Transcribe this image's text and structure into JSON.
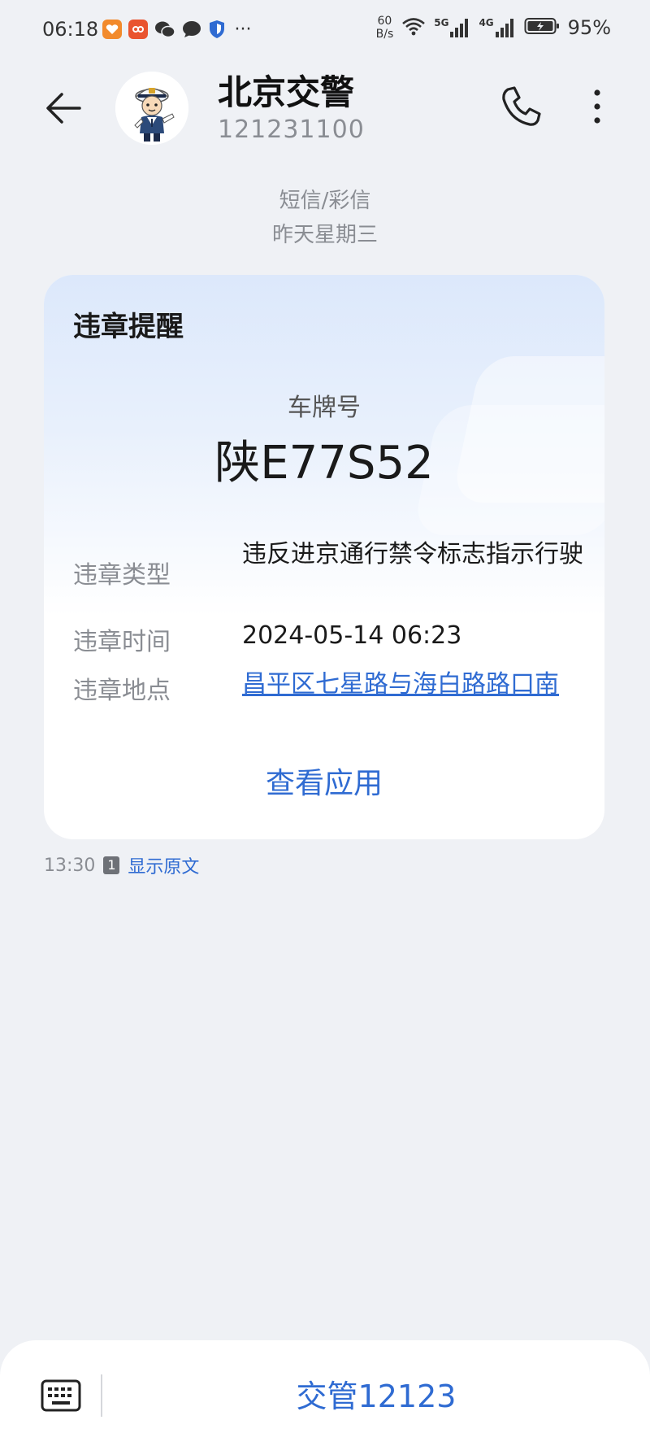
{
  "status_bar": {
    "time": "06:18",
    "net_speed_value": "60",
    "net_speed_unit": "B/s",
    "signal1_label": "5G",
    "signal2_label": "4G",
    "battery_percent": "95%",
    "more_dots": "···"
  },
  "header": {
    "contact_name": "北京交警",
    "contact_number": "121231100"
  },
  "thread": {
    "message_type": "短信/彩信",
    "date": "昨天星期三"
  },
  "card": {
    "title": "违章提醒",
    "plate_label": "车牌号",
    "plate_value": "陕E77S52",
    "rows": [
      {
        "label": "违章类型",
        "value": "违反进京通行禁令标志指示行驶"
      },
      {
        "label": "违章时间",
        "value": "2024-05-14 06:23"
      },
      {
        "label": "违章地点",
        "value": "昌平区七星路与海白路路口南"
      }
    ],
    "action_label": "查看应用"
  },
  "message_meta": {
    "time": "13:30",
    "sim": "1",
    "show_original": "显示原文"
  },
  "bottom_bar": {
    "quick_action": "交管12123"
  },
  "colors": {
    "accent": "#2f6bd2",
    "background": "#eff1f5",
    "muted_text": "#8a8d93"
  }
}
